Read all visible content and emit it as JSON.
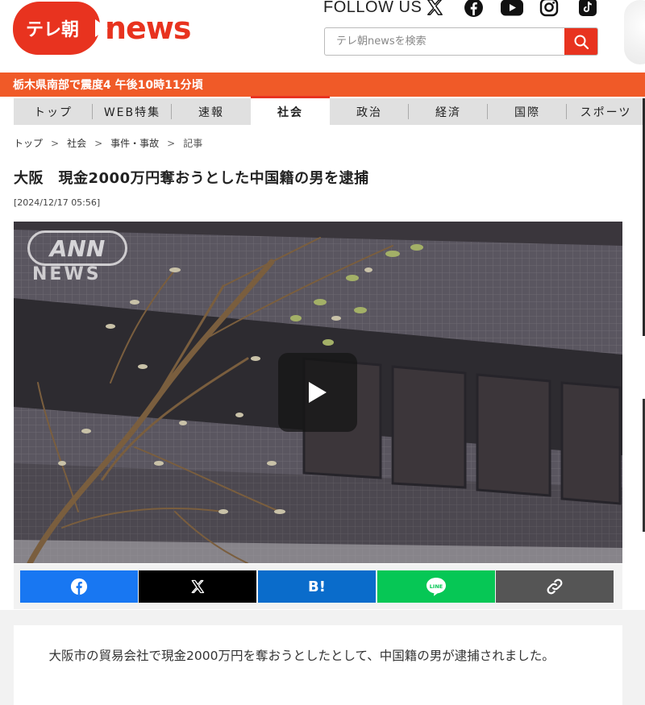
{
  "brand": {
    "logo_badge_text": "テレ朝",
    "logo_news_text": "news"
  },
  "header": {
    "follow_label": "FOLLOW US",
    "sns_icons": [
      "x-icon",
      "facebook-icon",
      "youtube-icon",
      "instagram-icon",
      "tiktok-icon"
    ],
    "search_placeholder": "テレ朝newsを検索"
  },
  "breaking": {
    "text": "栃木県南部で震度4 午後10時11分頃"
  },
  "nav": {
    "items": [
      {
        "label": "トップ",
        "active": false
      },
      {
        "label": "WEB特集",
        "active": false
      },
      {
        "label": "速報",
        "active": false
      },
      {
        "label": "社会",
        "active": true
      },
      {
        "label": "政治",
        "active": false
      },
      {
        "label": "経済",
        "active": false
      },
      {
        "label": "国際",
        "active": false
      },
      {
        "label": "スポーツ",
        "active": false
      }
    ]
  },
  "breadcrumb": {
    "items": [
      "トップ",
      "社会",
      "事件・事故",
      "記事"
    ],
    "separator": ">"
  },
  "article": {
    "title": "大阪　現金2000万円奪おうとした中国籍の男を逮捕",
    "date": "[2024/12/17 05:56]",
    "body": "大阪市の貿易会社で現金2000万円を奪おうとしたとして、中国籍の男が逮捕されました。"
  },
  "video": {
    "watermark_top": "ANN",
    "watermark_bottom": "NEWS"
  },
  "share": {
    "buttons": [
      {
        "name": "facebook",
        "color": "#1877f2"
      },
      {
        "name": "x",
        "color": "#000000"
      },
      {
        "name": "hatena",
        "color": "#0a6ccb",
        "label": "B!"
      },
      {
        "name": "line",
        "color": "#06c755"
      },
      {
        "name": "copy-link",
        "color": "#555555"
      }
    ]
  },
  "colors": {
    "brand_red": "#e8331f",
    "breaking_orange": "#f05a28",
    "nav_bg": "#e0e0e0"
  }
}
